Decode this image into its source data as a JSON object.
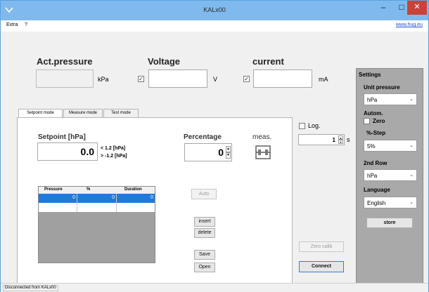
{
  "window": {
    "title": "KALx00",
    "icon": "app-icon",
    "minimize": "–",
    "maximize": "□",
    "close": "✕"
  },
  "menu": {
    "items": [
      "Extra",
      "?"
    ],
    "link": "www.hug.eu"
  },
  "readouts": {
    "pressure": {
      "label": "Act.pressure",
      "unit": "kPa",
      "value": ""
    },
    "voltage": {
      "label": "Voltage",
      "unit": "V",
      "value": "",
      "checked": true
    },
    "current": {
      "label": "current",
      "unit": "mA",
      "value": "",
      "checked": true
    }
  },
  "checkmark": "✓",
  "tabs": [
    "Setpoint mode",
    "Measure mode",
    "Test mode"
  ],
  "setpoint": {
    "label": "Setpoint [hPa]",
    "value": "0.0",
    "tol_plus": "< 1.2 [hPa]",
    "tol_minus": "> -1.2 [hPa]",
    "percentage_label": "Percentage",
    "percentage_value": "0",
    "meas_label": "meas.",
    "meas_icon": "gauge-icon"
  },
  "table": {
    "columns": [
      "Pressure",
      "%",
      "Duration"
    ],
    "rows": [
      [
        "0",
        "0",
        "0"
      ],
      [
        "",
        "",
        ""
      ]
    ]
  },
  "buttons": {
    "auto": "Auto",
    "insert": "insert",
    "delete": "delete",
    "save": "Save",
    "open": "Open",
    "zero_calib": "Zero calib",
    "connect": "Connect",
    "store": "store"
  },
  "log": {
    "label": "Log.",
    "value": "1",
    "unit": "s"
  },
  "settings": {
    "title": "Settings",
    "unit_pressure_label": "Unit pressure",
    "unit_pressure_value": "hPa",
    "autom_label": "Autom.",
    "zero_label": "Zero",
    "step_label": "%-Step",
    "step_value": "5%",
    "row2_label": "2nd Row",
    "row2_value": "hPa",
    "language_label": "Language",
    "language_value": "English"
  },
  "status": "Disconnected from KALx00"
}
